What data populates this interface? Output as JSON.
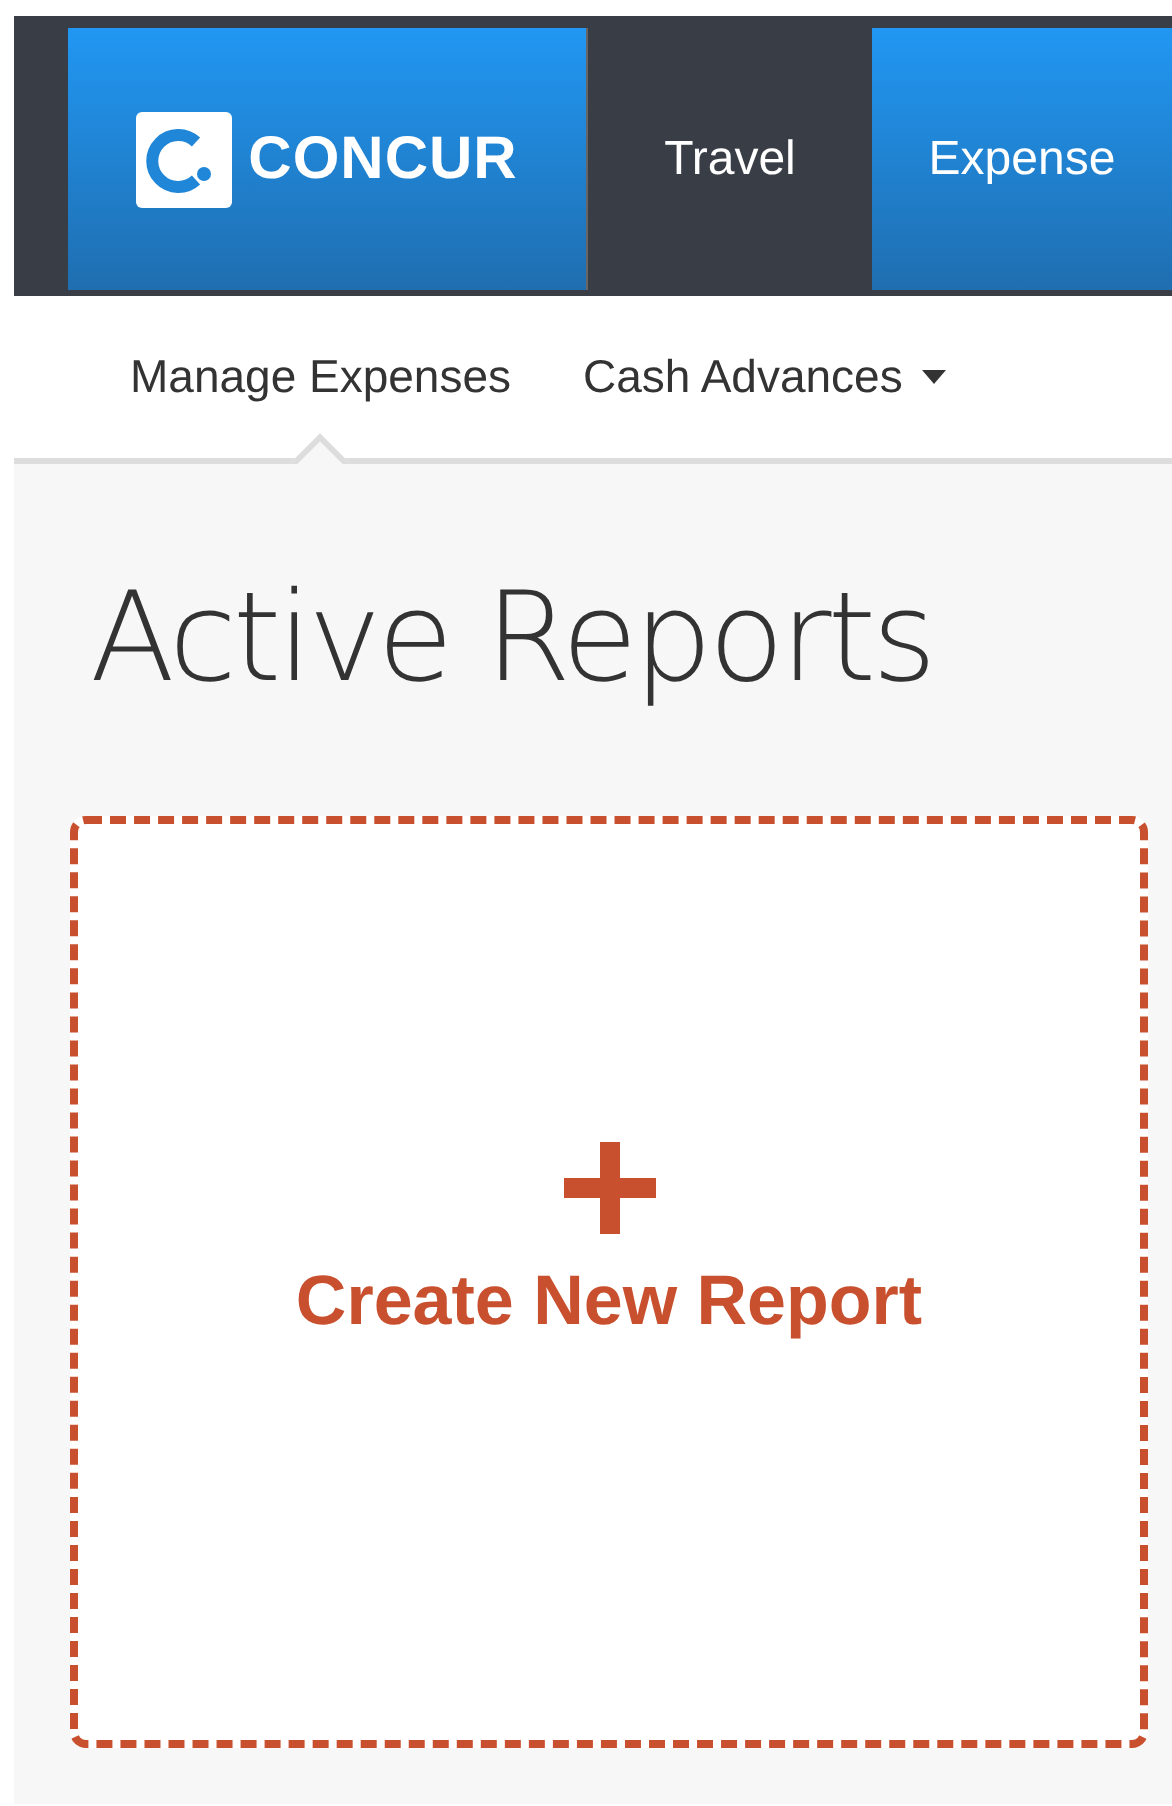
{
  "header": {
    "logo": {
      "text": "CONCUR"
    },
    "tabs": [
      {
        "label": "Travel",
        "selected": false
      },
      {
        "label": "Expense",
        "selected": true
      }
    ]
  },
  "subnav": {
    "items": [
      {
        "label": "Manage Expenses",
        "selected": true,
        "has_menu": false
      },
      {
        "label": "Cash Advances",
        "selected": false,
        "has_menu": true
      }
    ]
  },
  "page_title": "Active Reports",
  "create_card": {
    "label": "Create New Report"
  }
}
